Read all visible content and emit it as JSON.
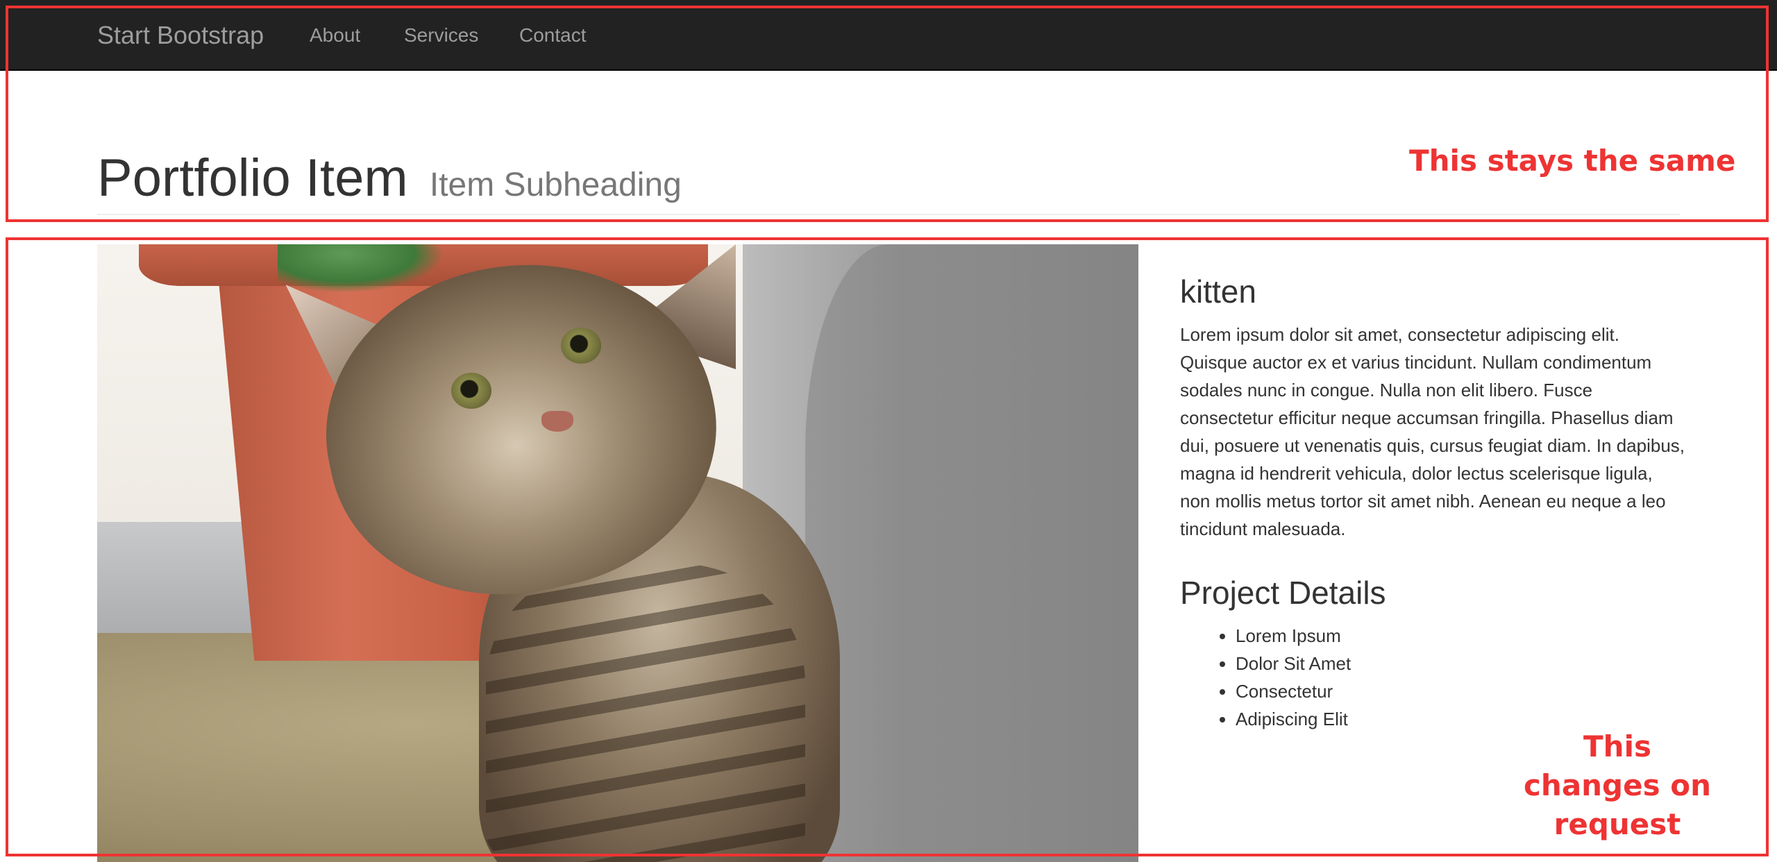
{
  "navbar": {
    "brand": "Start Bootstrap",
    "links": [
      {
        "label": "About"
      },
      {
        "label": "Services"
      },
      {
        "label": "Contact"
      }
    ],
    "background_color": "#222222",
    "link_color": "#9d9d9d"
  },
  "header": {
    "title": "Portfolio Item",
    "subtitle": "Item Subheading"
  },
  "item": {
    "image_subject": "kitten photo",
    "name": "kitten",
    "description": "Lorem ipsum dolor sit amet, consectetur adipiscing elit. Quisque auctor ex et varius tincidunt. Nullam condimentum sodales nunc in congue. Nulla non elit libero. Fusce consectetur efficitur neque accumsan fringilla. Phasellus diam dui, posuere ut venenatis quis, cursus feugiat diam. In dapibus, magna id hendrerit vehicula, dolor lectus scelerisque ligula, non mollis metus tortor sit amet nibh. Aenean eu neque a leo tincidunt malesuada.",
    "details_title": "Project Details",
    "details": [
      "Lorem Ipsum",
      "Dolor Sit Amet",
      "Consectetur",
      "Adipiscing Elit"
    ]
  },
  "annotations": {
    "top": "This stays the same",
    "bottom": "This changes on request",
    "color": "#ee3333"
  }
}
